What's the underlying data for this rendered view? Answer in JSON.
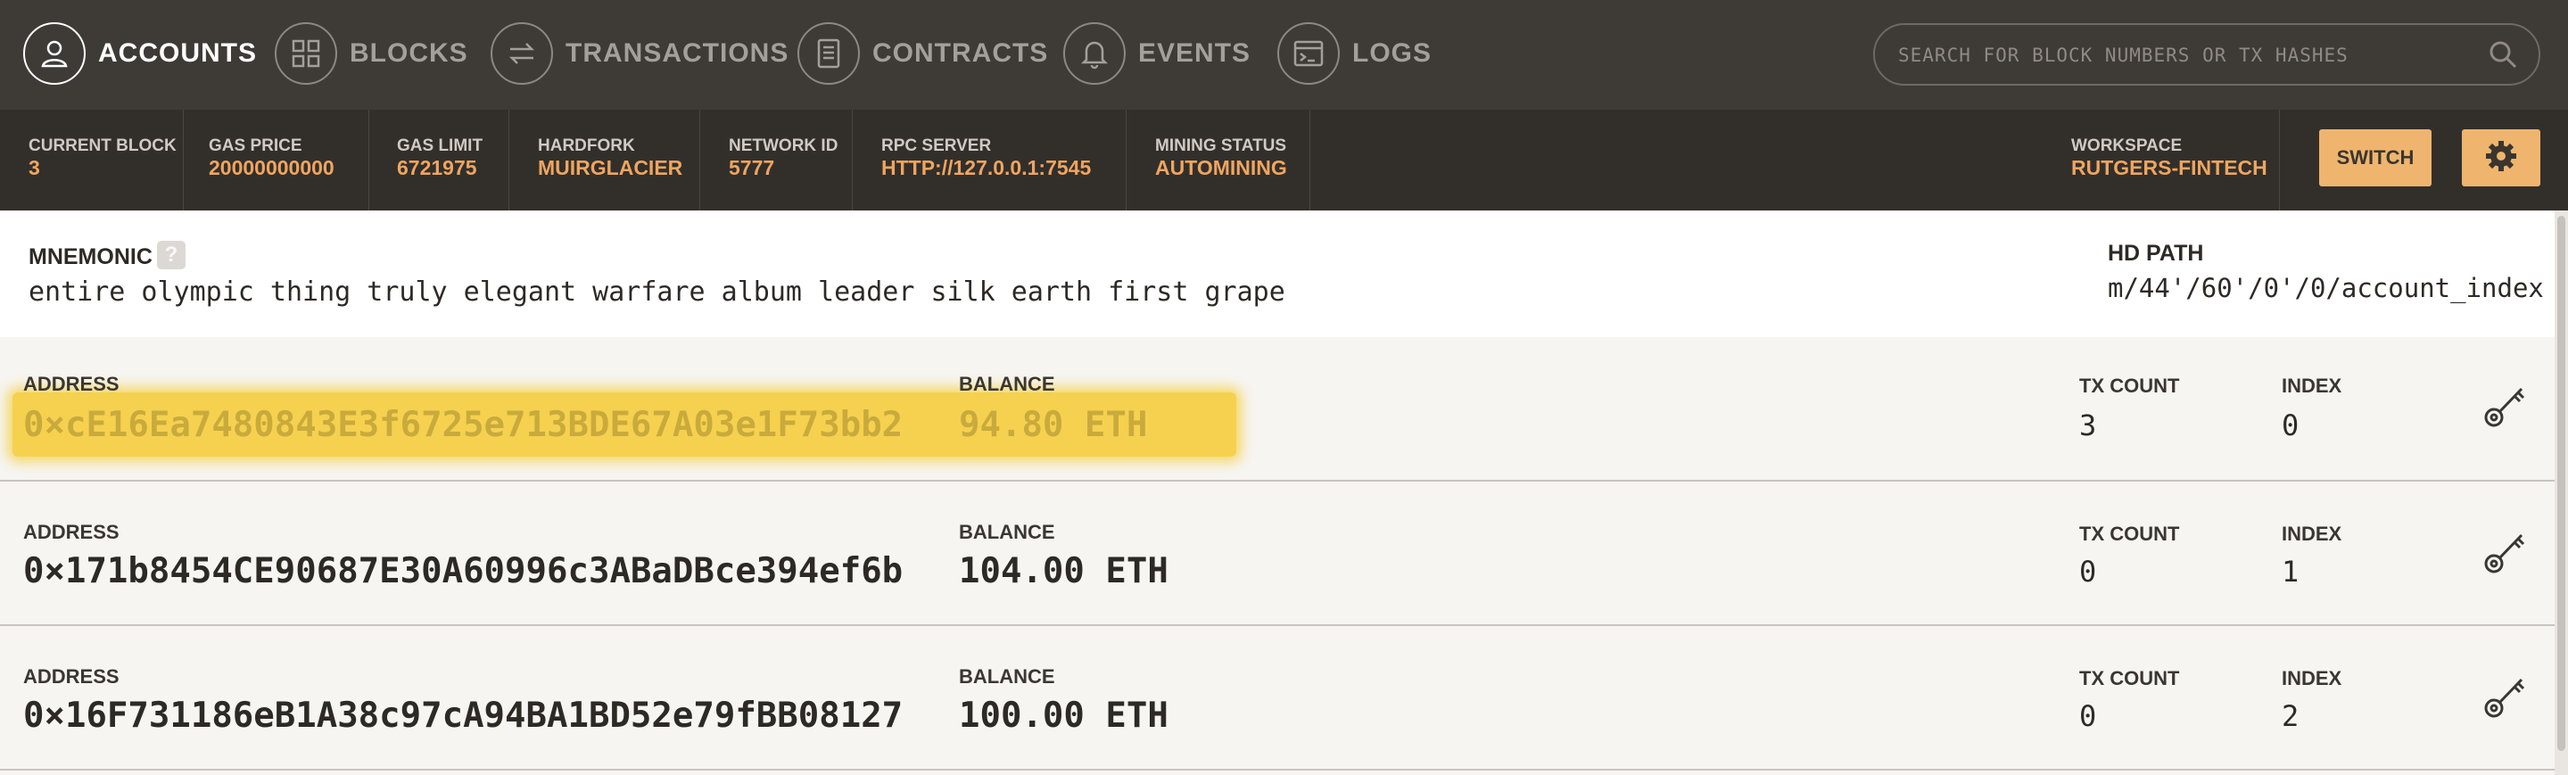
{
  "nav": {
    "items": [
      {
        "label": "ACCOUNTS",
        "icon": "account-icon",
        "active": true
      },
      {
        "label": "BLOCKS",
        "icon": "blocks-icon",
        "active": false
      },
      {
        "label": "TRANSACTIONS",
        "icon": "transactions-icon",
        "active": false
      },
      {
        "label": "CONTRACTS",
        "icon": "contracts-icon",
        "active": false
      },
      {
        "label": "EVENTS",
        "icon": "bell-icon",
        "active": false
      },
      {
        "label": "LOGS",
        "icon": "terminal-icon",
        "active": false
      }
    ],
    "search_placeholder": "SEARCH FOR BLOCK NUMBERS OR TX HASHES"
  },
  "status": {
    "current_block": {
      "label": "CURRENT BLOCK",
      "value": "3"
    },
    "gas_price": {
      "label": "GAS PRICE",
      "value": "20000000000"
    },
    "gas_limit": {
      "label": "GAS LIMIT",
      "value": "6721975"
    },
    "hardfork": {
      "label": "HARDFORK",
      "value": "MUIRGLACIER"
    },
    "network_id": {
      "label": "NETWORK ID",
      "value": "5777"
    },
    "rpc_server": {
      "label": "RPC SERVER",
      "value": "HTTP://127.0.0.1:7545"
    },
    "mining_status": {
      "label": "MINING STATUS",
      "value": "AUTOMINING"
    },
    "workspace": {
      "label": "WORKSPACE",
      "value": "RUTGERS-FINTECH"
    },
    "switch_label": "SWITCH"
  },
  "mnemonic": {
    "label": "MNEMONIC",
    "help": "?",
    "words": "entire olympic thing truly elegant warfare album leader silk earth first grape",
    "hd_path_label": "HD PATH",
    "hd_path": "m/44'/60'/0'/0/account_index"
  },
  "account_labels": {
    "address": "ADDRESS",
    "balance": "BALANCE",
    "tx_count": "TX COUNT",
    "index": "INDEX"
  },
  "accounts": [
    {
      "address": "0×cE16Ea7480843E3f6725e713BDE67A03e1F73bb2",
      "balance": "94.80 ETH",
      "tx_count": "3",
      "index": "0",
      "highlighted": true
    },
    {
      "address": "0×171b8454CE90687E30A60996c3ABaDBce394ef6b",
      "balance": "104.00 ETH",
      "tx_count": "0",
      "index": "1",
      "highlighted": false
    },
    {
      "address": "0×16F731186eB1A38c97cA94BA1BD52e79fBB08127",
      "balance": "100.00 ETH",
      "tx_count": "0",
      "index": "2",
      "highlighted": false
    }
  ],
  "colors": {
    "nav_bg": "#3e3b37",
    "status_bg": "#322f2b",
    "accent": "#efa560",
    "button": "#efb56e",
    "highlight": "#f5d14f"
  }
}
